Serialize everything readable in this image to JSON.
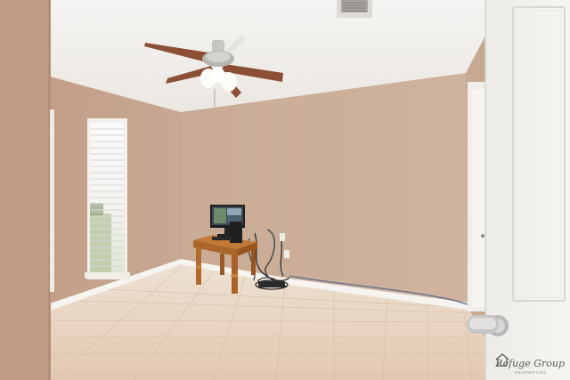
{
  "photo": {
    "subject": "Empty bedroom with tile floor, ceiling fan, window and small wooden table"
  },
  "watermark": {
    "brand": "Refuge Group",
    "tagline": "PROPERTIES"
  },
  "colors": {
    "wall": "#c9ad97",
    "ceiling": "#f3f1ee",
    "floor": "#e9d6c2",
    "trim": "#f4f1ec",
    "door": "#f2f0ec"
  }
}
